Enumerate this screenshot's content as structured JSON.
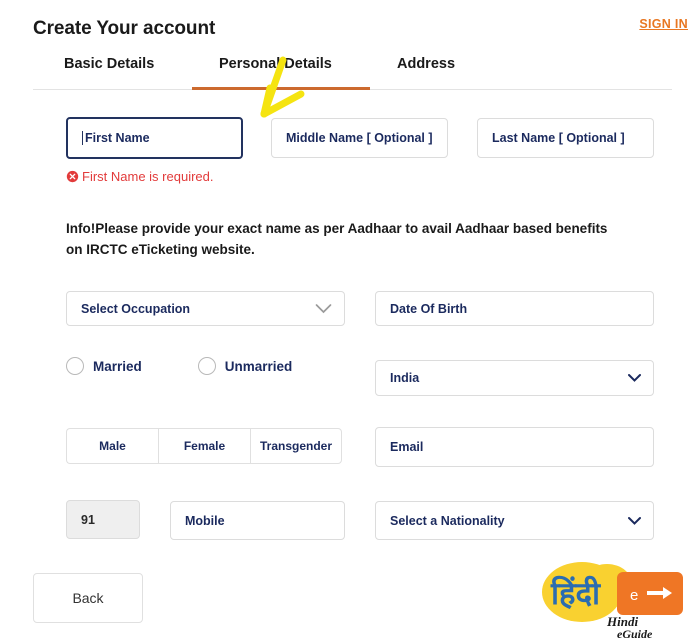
{
  "header": {
    "title": "Create Your account",
    "signin_label": "SIGN IN"
  },
  "tabs": {
    "items": [
      {
        "label": "Basic Details",
        "active": false
      },
      {
        "label": "Personal Details",
        "active": true
      },
      {
        "label": "Address",
        "active": false
      }
    ],
    "active_index": 1,
    "active_underline_color": "#cc6a2e"
  },
  "form": {
    "name_row": {
      "first_name": {
        "placeholder": "First Name",
        "value": "",
        "focused": true
      },
      "middle_name": {
        "placeholder": "Middle Name  [ Optional ]",
        "value": ""
      },
      "last_name": {
        "placeholder": "Last Name  [ Optional ]",
        "value": ""
      }
    },
    "error": {
      "text": "First Name is required.",
      "color": "#e23b3b",
      "icon": "error-circle-x-icon"
    },
    "info_note": "Info!Please provide your exact name as per Aadhaar to avail Aadhaar based benefits on IRCTC eTicketing website.",
    "occupation": {
      "placeholder": "Select Occupation",
      "value": "",
      "icon": "chevron-down-icon"
    },
    "date_of_birth": {
      "placeholder": "Date Of Birth",
      "value": ""
    },
    "marital_status": {
      "options": [
        {
          "label": "Married",
          "selected": false
        },
        {
          "label": "Unmarried",
          "selected": false
        }
      ]
    },
    "country": {
      "value": "India",
      "icon": "chevron-down-icon"
    },
    "gender": {
      "options": [
        {
          "label": "Male",
          "selected": false
        },
        {
          "label": "Female",
          "selected": false
        },
        {
          "label": "Transgender",
          "selected": false
        }
      ]
    },
    "email": {
      "placeholder": "Email",
      "value": ""
    },
    "country_code": {
      "value": "91",
      "disabled": true
    },
    "mobile": {
      "placeholder": "Mobile",
      "value": ""
    },
    "nationality": {
      "placeholder": "Select a Nationality",
      "value": "",
      "icon": "chevron-down-icon"
    }
  },
  "footer": {
    "back_label": "Back"
  },
  "watermark": {
    "devanagari": "हिंदी",
    "badge_text": "e",
    "line1": "Hindi",
    "line2": "eGuide",
    "yellow": "#f9d130",
    "orange": "#ef7625",
    "blue": "#2b6cb0"
  },
  "annotation": {
    "arrow_color": "#f5e411",
    "name": "highlight-arrow"
  },
  "colors": {
    "accent_orange": "#e87722",
    "field_text_navy": "#1b2a5e",
    "border_gray": "#dcdcdc",
    "focus_navy": "#22325f"
  }
}
